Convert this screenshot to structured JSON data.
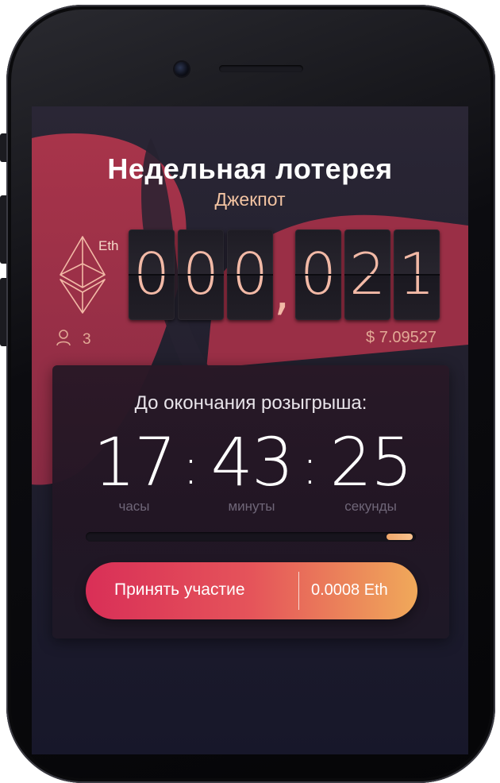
{
  "header": {
    "title": "Недельная лотерея",
    "subtitle": "Джекпот"
  },
  "jackpot": {
    "currency_label": "Eth",
    "currency_icon": "ethereum-icon",
    "digits": [
      "0",
      "0",
      "0",
      "0",
      "2",
      "1"
    ],
    "separator": ",",
    "usd_value": "$ 7.09527",
    "participants_icon": "user-icon",
    "participants_count": "3"
  },
  "timer": {
    "label": "До окончания розыгрыша:",
    "hours": "17",
    "minutes": "43",
    "seconds": "25",
    "separator": ":",
    "hours_label": "часы",
    "minutes_label": "минуты",
    "seconds_label": "секунды",
    "progress_fraction": 0.08
  },
  "cta": {
    "label": "Принять участие",
    "price": "0.0008 Eth"
  },
  "colors": {
    "accent_red": "#d92f57",
    "accent_orange": "#f0a95a",
    "digit_color": "#f2b9a6",
    "background": "#211f2d"
  }
}
